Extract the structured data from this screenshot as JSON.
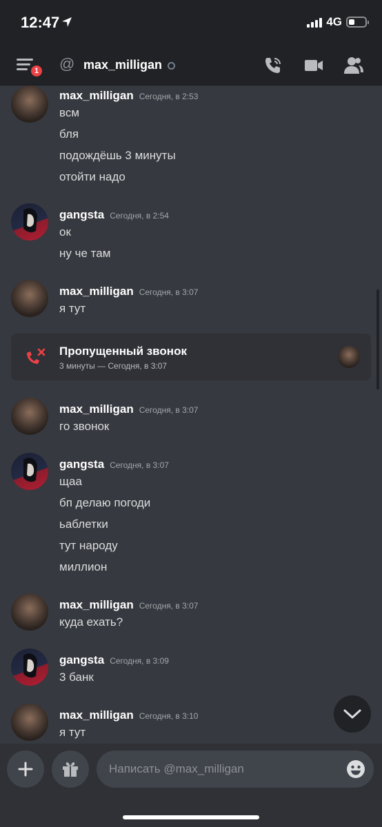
{
  "status_bar": {
    "time": "12:47",
    "network": "4G"
  },
  "header": {
    "badge_count": "1",
    "at_symbol": "@",
    "channel_name": "max_milligan"
  },
  "messages": [
    {
      "author": "max_milligan",
      "timestamp": "Сегодня, в 2:53",
      "avatar": "max",
      "lines": [
        "всм",
        "бля",
        "подождёшь 3 минуты",
        "отойти надо"
      ]
    },
    {
      "author": "gangsta",
      "timestamp": "Сегодня, в 2:54",
      "avatar": "gangsta",
      "lines": [
        "ок",
        "ну че там"
      ]
    },
    {
      "author": "max_milligan",
      "timestamp": "Сегодня, в 3:07",
      "avatar": "max",
      "lines": [
        "я тут"
      ]
    },
    {
      "author": "max_milligan",
      "timestamp": "Сегодня, в 3:07",
      "avatar": "max",
      "lines": [
        "го звонок"
      ]
    },
    {
      "author": "gangsta",
      "timestamp": "Сегодня, в 3:07",
      "avatar": "gangsta",
      "lines": [
        "щаа",
        "бп делаю погоди",
        "ьаблетки",
        "тут народу",
        "миллион"
      ]
    },
    {
      "author": "max_milligan",
      "timestamp": "Сегодня, в 3:07",
      "avatar": "max",
      "lines": [
        "куда ехать?"
      ]
    },
    {
      "author": "gangsta",
      "timestamp": "Сегодня, в 3:09",
      "avatar": "gangsta",
      "lines": [
        "3 банк"
      ]
    },
    {
      "author": "max_milligan",
      "timestamp": "Сегодня, в 3:10",
      "avatar": "max",
      "lines": [
        "я тут"
      ]
    }
  ],
  "missed_call": {
    "title": "Пропущенный звонок",
    "subtitle": "3 минуты — Сегодня, в 3:07"
  },
  "composer": {
    "placeholder": "Написать @max_milligan"
  },
  "colors": {
    "accent_red": "#ed4245",
    "background": "#36393f",
    "header": "#202225"
  }
}
